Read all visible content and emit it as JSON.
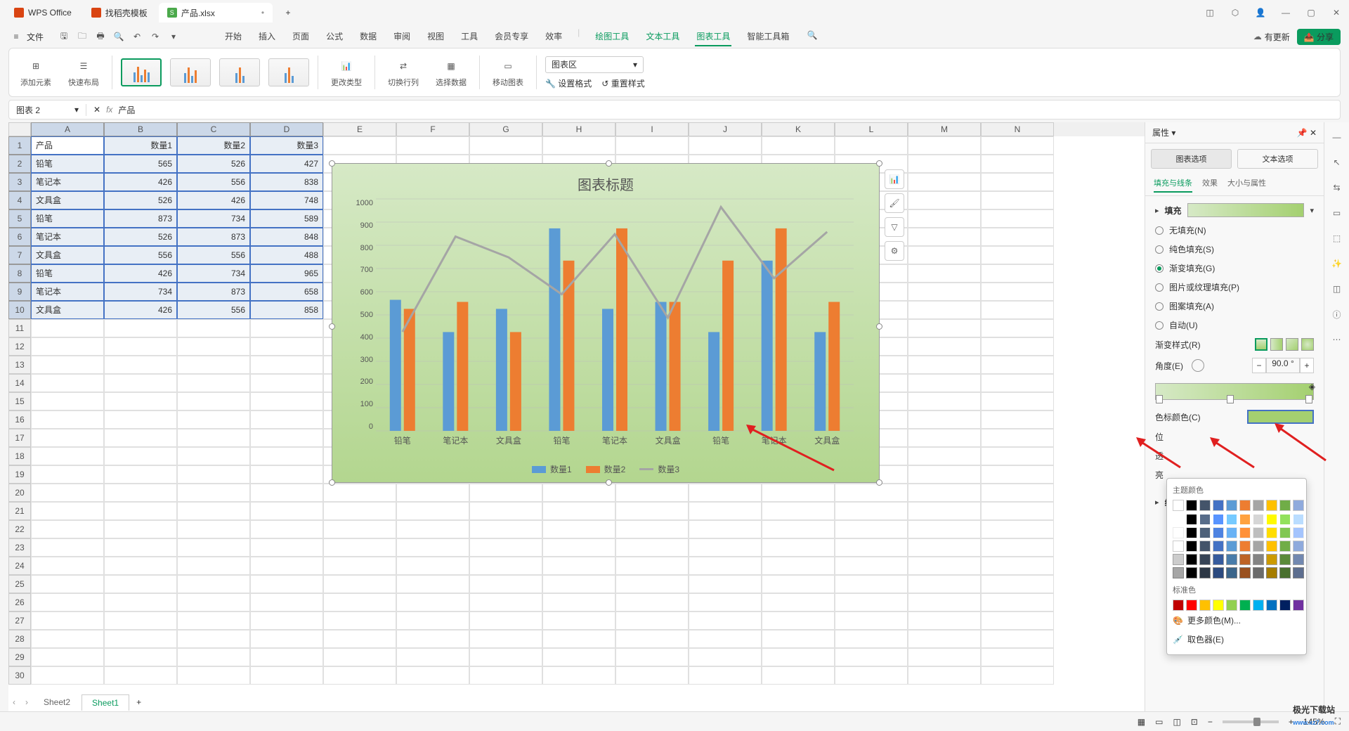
{
  "titlebar": {
    "tabs": [
      {
        "label": "WPS Office"
      },
      {
        "label": "找稻壳模板"
      },
      {
        "label": "产品.xlsx"
      }
    ]
  },
  "menubar": {
    "file": "文件",
    "tabs": [
      "开始",
      "插入",
      "页面",
      "公式",
      "数据",
      "审阅",
      "视图",
      "工具",
      "会员专享",
      "效率"
    ],
    "special_tabs": [
      "绘图工具",
      "文本工具",
      "图表工具",
      "智能工具箱"
    ],
    "update": "有更新",
    "share": "分享"
  },
  "ribbon": {
    "add_element": "添加元素",
    "quick_layout": "快速布局",
    "change_type": "更改类型",
    "switch_rowcol": "切换行列",
    "select_data": "选择数据",
    "move_chart": "移动图表",
    "chart_area": "图表区",
    "set_format": "设置格式",
    "reset_style": "重置样式"
  },
  "formula_bar": {
    "namebox": "图表 2",
    "formula": "产品"
  },
  "spreadsheet": {
    "cols": [
      "A",
      "B",
      "C",
      "D",
      "E",
      "F",
      "G",
      "H",
      "I",
      "J",
      "K",
      "L",
      "M",
      "N"
    ],
    "headers": [
      "产品",
      "数量1",
      "数量2",
      "数量3"
    ],
    "rows": [
      [
        "铅笔",
        "565",
        "526",
        "427"
      ],
      [
        "笔记本",
        "426",
        "556",
        "838"
      ],
      [
        "文具盒",
        "526",
        "426",
        "748"
      ],
      [
        "铅笔",
        "873",
        "734",
        "589"
      ],
      [
        "笔记本",
        "526",
        "873",
        "848"
      ],
      [
        "文具盒",
        "556",
        "556",
        "488"
      ],
      [
        "铅笔",
        "426",
        "734",
        "965"
      ],
      [
        "笔记本",
        "734",
        "873",
        "658"
      ],
      [
        "文具盒",
        "426",
        "556",
        "858"
      ]
    ]
  },
  "chart_data": {
    "type": "bar",
    "title": "图表标题",
    "categories": [
      "铅笔",
      "笔记本",
      "文具盒",
      "铅笔",
      "笔记本",
      "文具盒",
      "铅笔",
      "笔记本",
      "文具盒"
    ],
    "series": [
      {
        "name": "数量1",
        "values": [
          565,
          426,
          526,
          873,
          526,
          556,
          426,
          734,
          426
        ],
        "color": "#5b9bd5",
        "kind": "bar"
      },
      {
        "name": "数量2",
        "values": [
          526,
          556,
          426,
          734,
          873,
          556,
          734,
          873,
          556
        ],
        "color": "#ed7d31",
        "kind": "bar"
      },
      {
        "name": "数量3",
        "values": [
          427,
          838,
          748,
          589,
          848,
          488,
          965,
          658,
          858
        ],
        "color": "#a5a5a5",
        "kind": "line"
      }
    ],
    "ylim": [
      0,
      1000
    ],
    "yticks": [
      0,
      100,
      200,
      300,
      400,
      500,
      600,
      700,
      800,
      900,
      1000
    ]
  },
  "right_panel": {
    "title": "属性",
    "main_tabs": [
      "图表选项",
      "文本选项"
    ],
    "sub_tabs": [
      "填充与线条",
      "效果",
      "大小与属性"
    ],
    "section": "填充",
    "fill_options": [
      "无填充(N)",
      "纯色填充(S)",
      "渐变填充(G)",
      "图片或纹理填充(P)",
      "图案填充(A)",
      "自动(U)"
    ],
    "gradient_style": "渐变样式(R)",
    "angle_label": "角度(E)",
    "angle_value": "90.0",
    "angle_unit": "°",
    "color_label": "色标颜色(C)",
    "position_label": "位",
    "transparency_label": "透",
    "brightness_label": "亮",
    "line_label": "线"
  },
  "color_popup": {
    "theme_title": "主题颜色",
    "standard_title": "标准色",
    "theme_colors": [
      "#ffffff",
      "#000000",
      "#44546a",
      "#4472c4",
      "#5b9bd5",
      "#ed7d31",
      "#a5a5a5",
      "#ffc000",
      "#70ad47",
      "#8faadc"
    ],
    "more": "更多颜色(M)...",
    "picker": "取色器(E)"
  },
  "sheet_tabs": [
    "Sheet2",
    "Sheet1"
  ],
  "statusbar": {
    "zoom": "145%"
  },
  "watermark": {
    "main": "极光下载站",
    "sub": "www.xz7.com"
  }
}
